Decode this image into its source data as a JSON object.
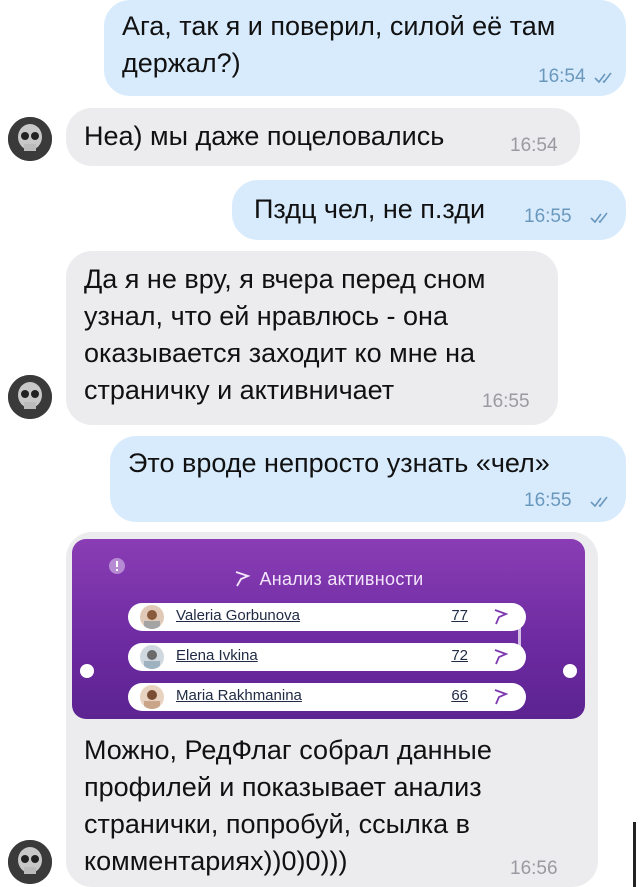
{
  "messages": [
    {
      "text": "Ага, так я и поверил, силой её там держал?)",
      "time": "16:54"
    },
    {
      "text": "Неа) мы даже поцеловались",
      "time": "16:54"
    },
    {
      "text": "Пздц чел, не п.зди",
      "time": "16:55"
    },
    {
      "text": "Да я не вру, я вчера перед сном узнал, что ей нравлюсь - она оказывается заходит ко мне на страничку и активничает",
      "time": "16:55"
    },
    {
      "text": "Это вроде непросто узнать «чел»",
      "time": "16:55"
    },
    {
      "text": "Можно, РедФлаг собрал данные профилей и показывает анализ странички, попробуй, ссылка в комментариях))0)0)))",
      "time": "16:56"
    }
  ],
  "activity_card": {
    "title": "Анализ активности",
    "rows": [
      {
        "name": "Valeria Gorbunova",
        "score": "77"
      },
      {
        "name": "Elena Ivkina",
        "score": "72"
      },
      {
        "name": "Maria Rakhmanina",
        "score": "66"
      }
    ]
  },
  "colors": {
    "outgoing_bubble": "#d8ebfd",
    "incoming_bubble": "#ececee",
    "card_purple": "#6c2aa0",
    "time_outgoing": "#6a98bd",
    "time_incoming": "#9a9aa0"
  },
  "icons": [
    "read-checkmarks-icon",
    "sender-avatar",
    "redflag-logo-icon",
    "alert-dot-icon"
  ]
}
